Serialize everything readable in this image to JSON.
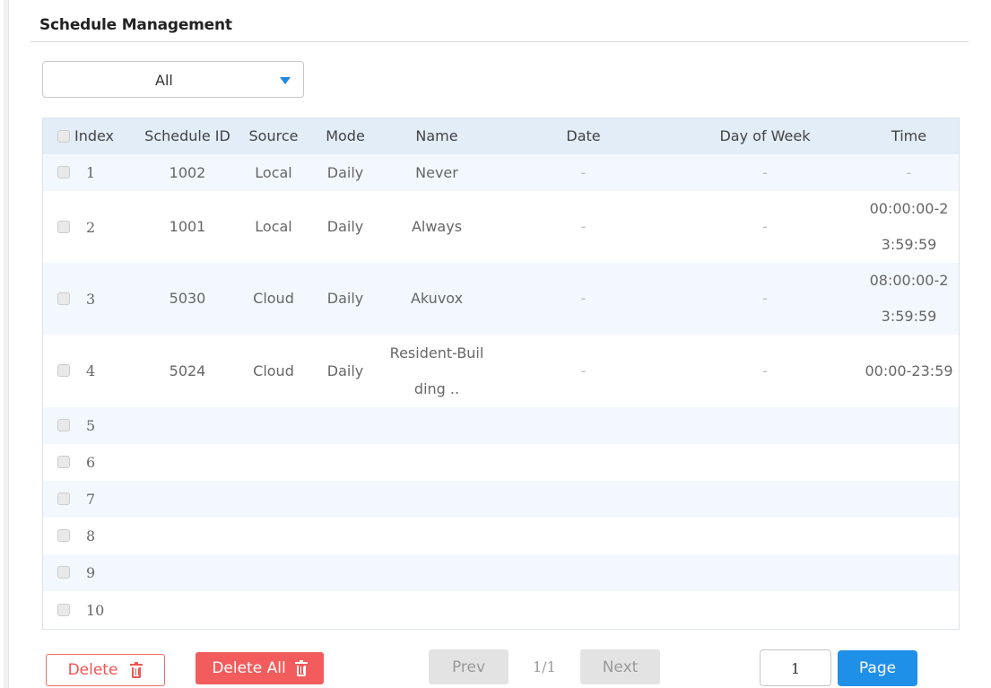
{
  "page": {
    "title": "Schedule Management"
  },
  "filter": {
    "selected": "All"
  },
  "table": {
    "headers": {
      "index": "Index",
      "schedule_id": "Schedule ID",
      "source": "Source",
      "mode": "Mode",
      "name": "Name",
      "date": "Date",
      "day_of_week": "Day of Week",
      "time": "Time"
    },
    "rows": [
      {
        "index": "1",
        "schedule_id": "1002",
        "source": "Local",
        "mode": "Daily",
        "name": "Never",
        "date": "-",
        "day_of_week": "-",
        "time": "-"
      },
      {
        "index": "2",
        "schedule_id": "1001",
        "source": "Local",
        "mode": "Daily",
        "name": "Always",
        "date": "-",
        "day_of_week": "-",
        "time_line1": "00:00:00-2",
        "time_line2": "3:59:59"
      },
      {
        "index": "3",
        "schedule_id": "5030",
        "source": "Cloud",
        "mode": "Daily",
        "name": "Akuvox",
        "date": "-",
        "day_of_week": "-",
        "time_line1": "08:00:00-2",
        "time_line2": "3:59:59"
      },
      {
        "index": "4",
        "schedule_id": "5024",
        "source": "Cloud",
        "mode": "Daily",
        "name_line1": "Resident-Buil",
        "name_line2": "ding ..",
        "date": "-",
        "day_of_week": "-",
        "time": "00:00-23:59"
      },
      {
        "index": "5"
      },
      {
        "index": "6"
      },
      {
        "index": "7"
      },
      {
        "index": "8"
      },
      {
        "index": "9"
      },
      {
        "index": "10"
      }
    ]
  },
  "actions": {
    "delete_label": "Delete",
    "delete_all_label": "Delete All",
    "prev_label": "Prev",
    "next_label": "Next",
    "page_info": "1/1",
    "page_input_value": "1",
    "page_button_label": "Page"
  },
  "colors": {
    "accent": "#1e90e8",
    "danger": "#f25c5c",
    "header_bg": "#e2edf7",
    "row_alt_bg": "#f2f8fd"
  },
  "icons": {
    "dropdown": "caret-down-icon",
    "delete": "trash-icon"
  }
}
